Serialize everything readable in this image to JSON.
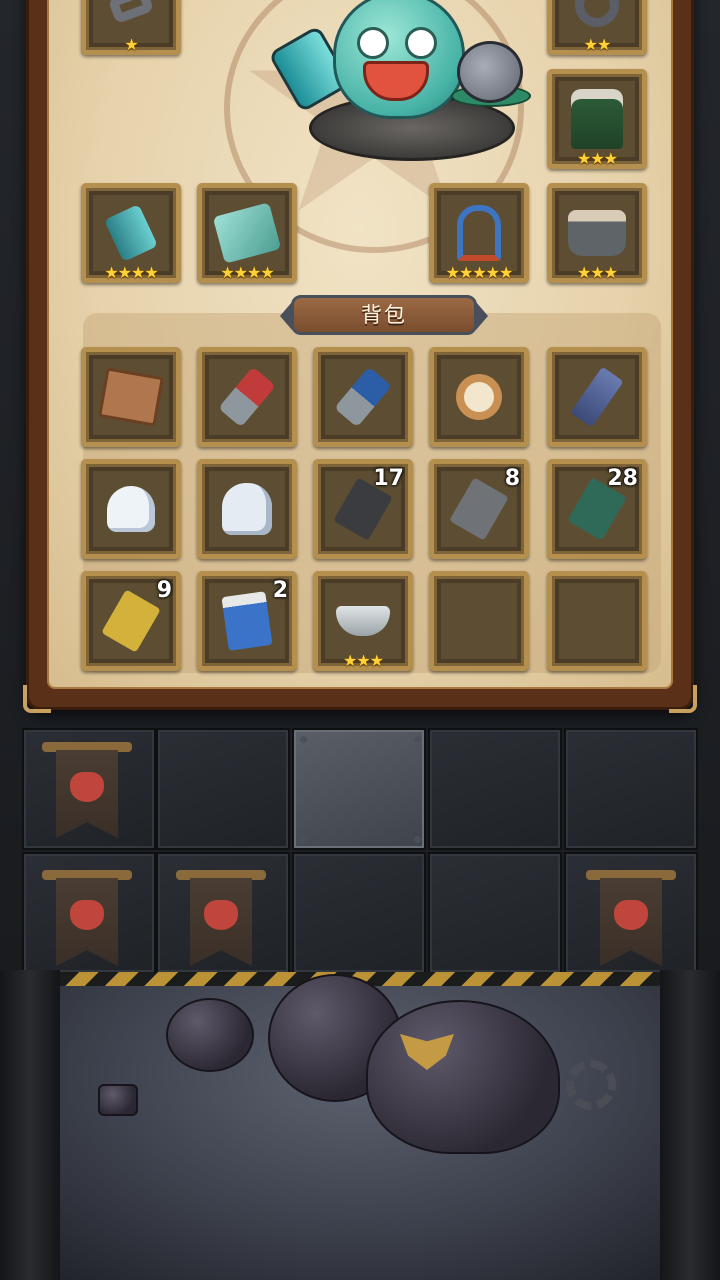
{
  "backpack": {
    "title": "背包",
    "rows": [
      [
        {
          "icon": "book-icon",
          "count": "",
          "stars": ""
        },
        {
          "icon": "red-spool-icon",
          "count": "",
          "stars": ""
        },
        {
          "icon": "blue-spool-icon",
          "count": "",
          "stars": ""
        },
        {
          "icon": "compass-icon",
          "count": "",
          "stars": ""
        },
        {
          "icon": "walkie-talkie-icon",
          "count": "",
          "stars": ""
        }
      ],
      [
        {
          "icon": "ghost-icon",
          "count": "",
          "stars": ""
        },
        {
          "icon": "angry-ghost-icon",
          "count": "",
          "stars": ""
        },
        {
          "icon": "black-transistor-icon",
          "count": "17",
          "stars": ""
        },
        {
          "icon": "gray-transistor-icon",
          "count": "8",
          "stars": ""
        },
        {
          "icon": "green-transistor-icon",
          "count": "28",
          "stars": ""
        }
      ],
      [
        {
          "icon": "yellow-transistor-icon",
          "count": "9",
          "stars": ""
        },
        {
          "icon": "battery-icon",
          "count": "2",
          "stars": ""
        },
        {
          "icon": "visor-icon",
          "count": "",
          "stars": "★★★"
        },
        {
          "icon": "empty",
          "count": "",
          "stars": ""
        },
        {
          "icon": "empty",
          "count": "",
          "stars": ""
        }
      ]
    ]
  },
  "equipment": {
    "helmet": {
      "icon": "metal-helmet-icon",
      "stars": "★"
    },
    "ring": {
      "icon": "ring-icon",
      "stars": "★★"
    },
    "armor": {
      "icon": "fur-armor-icon",
      "stars": "★★★"
    },
    "cup": {
      "icon": "teal-cup-icon",
      "stars": "★★★★"
    },
    "chip": {
      "icon": "circuit-plate-icon",
      "stars": "★★★★"
    },
    "harp": {
      "icon": "harp-icon",
      "stars": "★★★★★"
    },
    "boots": {
      "icon": "fur-boots-icon",
      "stars": "★★★"
    }
  },
  "pet": {
    "icon": "slime-pet-icon"
  },
  "colors": {
    "parchment": "#e6d2ab",
    "frame": "#5a3118",
    "slot_border": "#b58f4e",
    "star": "#ffd23a"
  }
}
